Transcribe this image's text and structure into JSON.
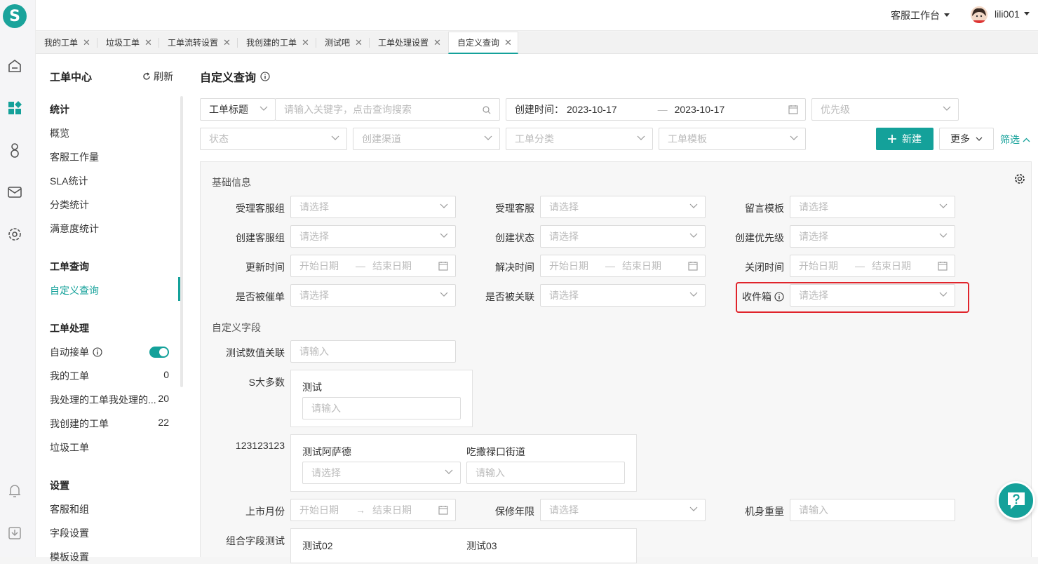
{
  "topbar": {
    "workspace": "客服工作台",
    "user": "lili001"
  },
  "tabs": [
    {
      "label": "我的工单"
    },
    {
      "label": "垃圾工单"
    },
    {
      "label": "工单流转设置"
    },
    {
      "label": "我创建的工单"
    },
    {
      "label": "测试吧"
    },
    {
      "label": "工单处理设置"
    },
    {
      "label": "自定义查询"
    }
  ],
  "sidebar": {
    "title": "工单中心",
    "refresh": "刷新",
    "stats_group": "统计",
    "stats": [
      "概览",
      "客服工作量",
      "SLA统计",
      "分类统计",
      "满意度统计"
    ],
    "query_group": "工单查询",
    "query_item": "自定义查询",
    "process_group": "工单处理",
    "auto_accept": "自动接单",
    "process_items": [
      {
        "label": "我的工单",
        "count": "0"
      },
      {
        "label": "我处理的工单我处理的...",
        "count": "20"
      },
      {
        "label": "我创建的工单",
        "count": "22"
      },
      {
        "label": "垃圾工单",
        "count": ""
      }
    ],
    "settings_group": "设置",
    "settings": [
      "客服和组",
      "字段设置",
      "模板设置"
    ]
  },
  "main": {
    "title": "自定义查询",
    "filters": {
      "field_select": "工单标题",
      "keyword_placeholder": "请输入关键字，点击查询搜索",
      "created_label": "创建时间：",
      "date_from": "2023-10-17",
      "date_to": "2023-10-17",
      "priority": "优先级",
      "status": "状态",
      "channel": "创建渠道",
      "category": "工单分类",
      "template": "工单模板",
      "new_btn": "新建",
      "more_btn": "更多",
      "filter_btn": "筛选"
    },
    "basic": {
      "section": "基础信息",
      "select_ph": "请选择",
      "start_ph": "开始日期",
      "end_ph": "结束日期",
      "labels": {
        "group": "受理客服组",
        "agent": "受理客服",
        "msg_template": "留言模板",
        "create_group": "创建客服组",
        "create_status": "创建状态",
        "create_priority": "创建优先级",
        "update_time": "更新时间",
        "resolve_time": "解决时间",
        "close_time": "关闭时间",
        "urged": "是否被催单",
        "linked": "是否被关联",
        "inbox": "收件箱"
      }
    },
    "custom": {
      "section": "自定义字段",
      "input_ph": "请输入",
      "numeric_link": "测试数值关联",
      "s_many": "S大多数",
      "s_sub": "测试",
      "num_field": "123123123",
      "sub_asade": "测试阿萨德",
      "sub_street": "吃撒禄口街道",
      "launch_month": "上市月份",
      "warranty": "保修年限",
      "weight": "机身重量",
      "combo": "组合字段测试",
      "combo_a": "测试02",
      "combo_b": "测试03"
    }
  }
}
